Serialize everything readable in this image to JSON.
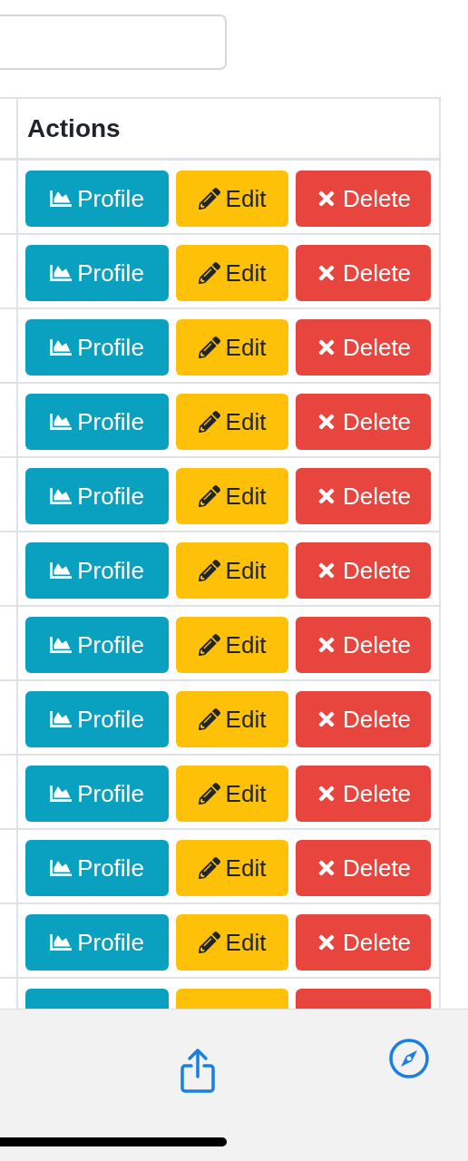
{
  "table": {
    "columns": [
      "Actions"
    ],
    "rows": [
      {
        "actions": [
          {
            "kind": "profile",
            "label": "Profile"
          },
          {
            "kind": "edit",
            "label": "Edit"
          },
          {
            "kind": "delete",
            "label": "Delete"
          }
        ]
      },
      {
        "actions": [
          {
            "kind": "profile",
            "label": "Profile"
          },
          {
            "kind": "edit",
            "label": "Edit"
          },
          {
            "kind": "delete",
            "label": "Delete"
          }
        ]
      },
      {
        "actions": [
          {
            "kind": "profile",
            "label": "Profile"
          },
          {
            "kind": "edit",
            "label": "Edit"
          },
          {
            "kind": "delete",
            "label": "Delete"
          }
        ]
      },
      {
        "actions": [
          {
            "kind": "profile",
            "label": "Profile"
          },
          {
            "kind": "edit",
            "label": "Edit"
          },
          {
            "kind": "delete",
            "label": "Delete"
          }
        ]
      },
      {
        "actions": [
          {
            "kind": "profile",
            "label": "Profile"
          },
          {
            "kind": "edit",
            "label": "Edit"
          },
          {
            "kind": "delete",
            "label": "Delete"
          }
        ]
      },
      {
        "actions": [
          {
            "kind": "profile",
            "label": "Profile"
          },
          {
            "kind": "edit",
            "label": "Edit"
          },
          {
            "kind": "delete",
            "label": "Delete"
          }
        ]
      },
      {
        "actions": [
          {
            "kind": "profile",
            "label": "Profile"
          },
          {
            "kind": "edit",
            "label": "Edit"
          },
          {
            "kind": "delete",
            "label": "Delete"
          }
        ]
      },
      {
        "actions": [
          {
            "kind": "profile",
            "label": "Profile"
          },
          {
            "kind": "edit",
            "label": "Edit"
          },
          {
            "kind": "delete",
            "label": "Delete"
          }
        ]
      },
      {
        "actions": [
          {
            "kind": "profile",
            "label": "Profile"
          },
          {
            "kind": "edit",
            "label": "Edit"
          },
          {
            "kind": "delete",
            "label": "Delete"
          }
        ]
      },
      {
        "actions": [
          {
            "kind": "profile",
            "label": "Profile"
          },
          {
            "kind": "edit",
            "label": "Edit"
          },
          {
            "kind": "delete",
            "label": "Delete"
          }
        ]
      },
      {
        "actions": [
          {
            "kind": "profile",
            "label": "Profile"
          },
          {
            "kind": "edit",
            "label": "Edit"
          },
          {
            "kind": "delete",
            "label": "Delete"
          }
        ]
      },
      {
        "actions": [
          {
            "kind": "profile"
          },
          {
            "kind": "edit"
          },
          {
            "kind": "delete"
          }
        ]
      }
    ]
  }
}
